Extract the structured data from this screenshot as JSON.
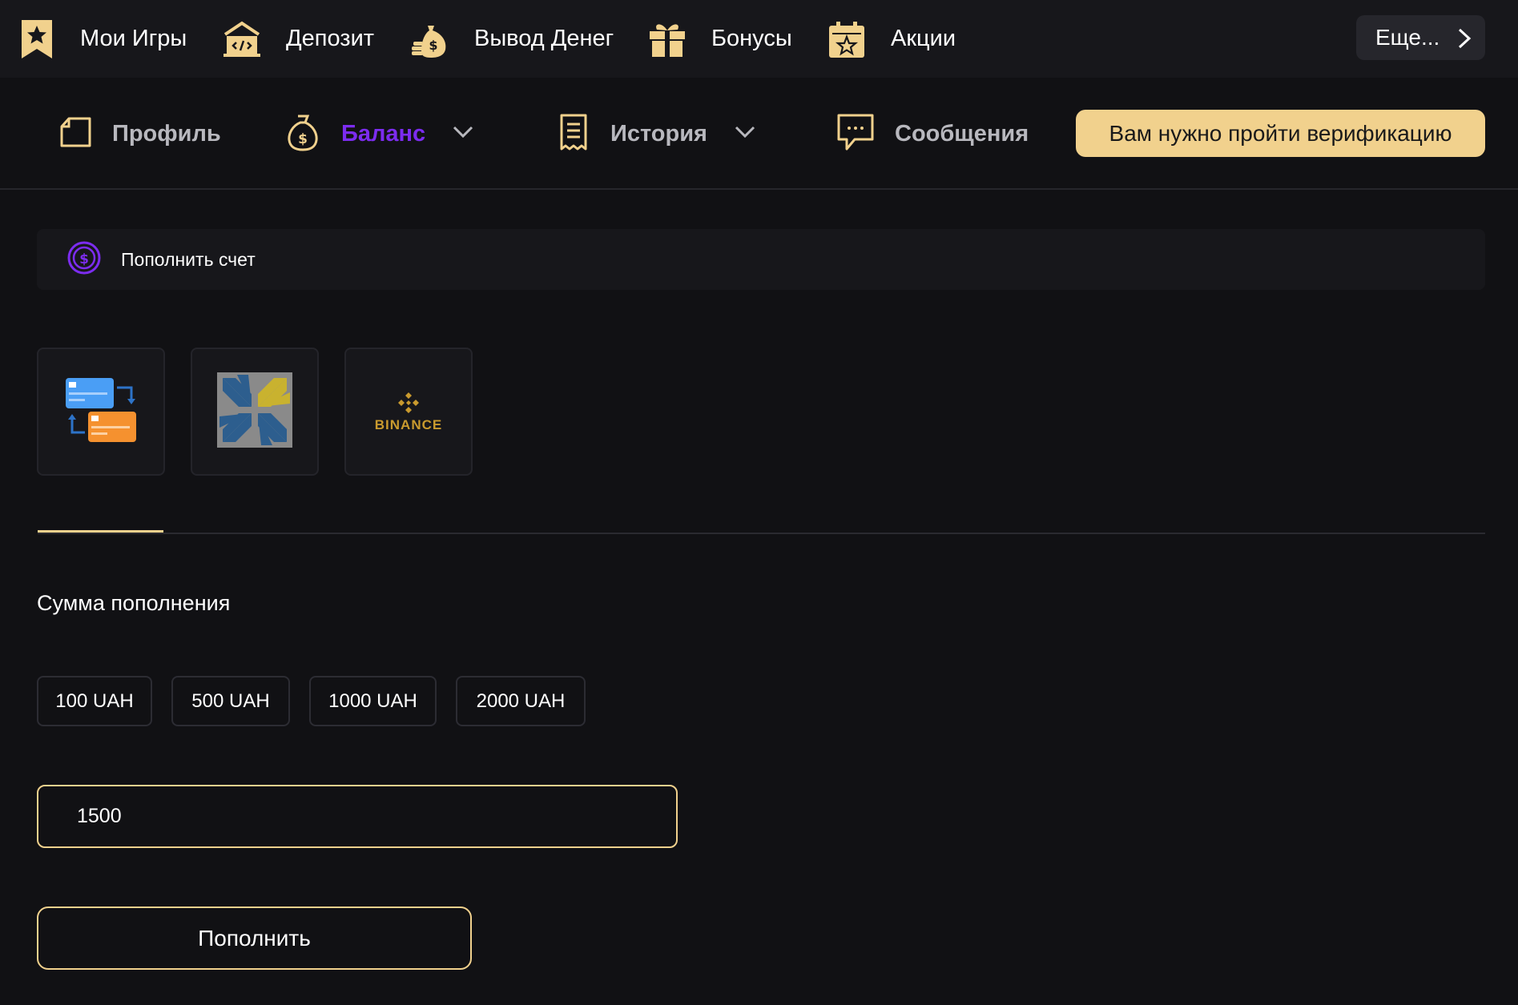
{
  "topnav": {
    "items": [
      {
        "label": "Мои Игры",
        "icon": "star-bookmark-icon"
      },
      {
        "label": "Депозит",
        "icon": "deposit-icon"
      },
      {
        "label": "Вывод Денег",
        "icon": "money-bag-icon"
      },
      {
        "label": "Бонусы",
        "icon": "gift-icon"
      },
      {
        "label": "Акции",
        "icon": "calendar-star-icon"
      }
    ],
    "more_label": "Еще..."
  },
  "subnav": {
    "profile_label": "Профиль",
    "balance_label": "Баланс",
    "history_label": "История",
    "messages_label": "Сообщения",
    "verify_label": "Вам нужно пройти верификацию"
  },
  "deposit": {
    "header_label": "Пополнить счет",
    "methods": [
      "card-transfer-icon",
      "pattern-logo-icon",
      "binance-logo-icon"
    ],
    "binance_text": "BINANCE",
    "amount_title": "Сумма пополнения",
    "chips": [
      "100 UAH",
      "500 UAH",
      "1000 UAH",
      "2000 UAH"
    ],
    "amount_value": "1500",
    "submit_label": "Пополнить"
  },
  "colors": {
    "accent": "#f1d18d",
    "active_nav": "#7c2cf0",
    "background": "#111114",
    "panel": "#17171b"
  }
}
